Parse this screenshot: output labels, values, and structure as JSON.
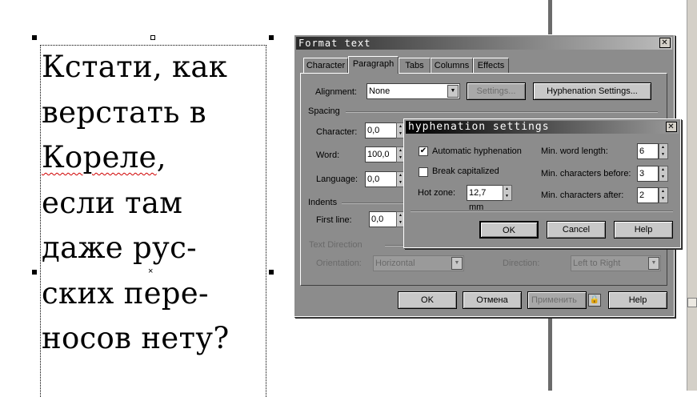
{
  "frame_text": {
    "lines": [
      "Кстати, как",
      "верстать в",
      "Кореле",
      ",",
      "если там",
      "даже рус-",
      "ских пере-",
      "носов нету?"
    ]
  },
  "format_text": {
    "title": "Format text",
    "tabs": [
      "Character",
      "Paragraph",
      "Tabs",
      "Columns",
      "Effects"
    ],
    "alignment_label": "Alignment:",
    "alignment_value": "None",
    "settings_button": "Settings...",
    "hyphenation_settings_button": "Hyphenation Settings...",
    "spacing_label": "Spacing",
    "character_label": "Character:",
    "character_value": "0,0",
    "word_label": "Word:",
    "word_value": "100,0",
    "language_label": "Language:",
    "language_value": "0,0",
    "indents_label": "Indents",
    "first_line_label": "First line:",
    "first_line_value": "0,0",
    "text_direction_label": "Text Direction",
    "orientation_label": "Orientation:",
    "orientation_value": "Horizontal",
    "direction_label": "Direction:",
    "direction_value": "Left to Right",
    "ok_button": "OK",
    "cancel_button": "Отмена",
    "apply_button": "Применить",
    "help_button": "Help"
  },
  "hyphenation": {
    "title": "hyphenation settings",
    "automatic_label": "Automatic hyphenation",
    "automatic_checked": true,
    "break_cap_label": "Break capitalized",
    "break_cap_checked": false,
    "hot_zone_label": "Hot zone:",
    "hot_zone_value": "12,7 mm",
    "min_word_label": "Min. word length:",
    "min_word_value": "6",
    "min_before_label": "Min. characters before:",
    "min_before_value": "3",
    "min_after_label": "Min. characters after:",
    "min_after_value": "2",
    "ok_button": "OK",
    "cancel_button": "Cancel",
    "help_button": "Help"
  },
  "colors": {
    "titlebar_start": "#2a2a2a",
    "titlebar_end": "#bdbdbd",
    "dialog_bg": "#8c8c8c"
  }
}
